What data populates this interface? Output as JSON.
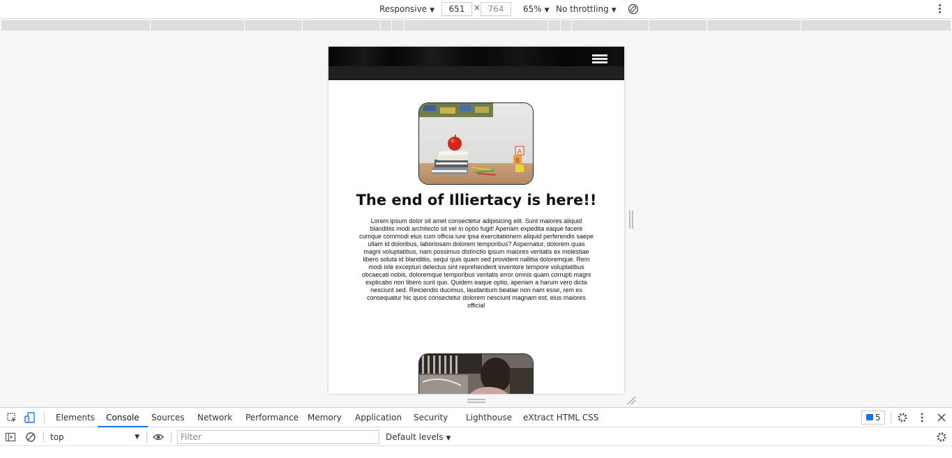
{
  "device_toolbar": {
    "device_mode": "Responsive",
    "width_value": "651",
    "height_value": "764",
    "dimension_separator": "×",
    "zoom": "65%",
    "throttling": "No throttling"
  },
  "page": {
    "headline": "The end of Illiertacy is here!!",
    "body": "Lorem ipsum dolor sit amet consectetur adipisicing elit. Sunt maiores aliquid blanditiis modi architecto sit vel in optio fugit! Aperiam expedita eaque facere cumque commodi eius cum officia iure ipsa exercitationem aliquid perferendis saepe ullam id doloribus, laboriosam dolorem temporibus? Aspernatur, dolorem quas magni voluptatibus, nam possimus distinctio ipsum maiores veritatis ex molestiae libero soluta id blanditiis, sequi quis quam sed provident nallitia doloremque. Rem modi iste excepturi delectus sint reprehenderit inventore tempore voluptatibus obcaecati nobis, doloremque temporibus veritatis error omnis quam corrupti magni explicabo non libero sunt quo. Quidem eaque optio, aperiam a harum vero dicta nesciunt sed. Reiciendis ducimus, laudantium beatae non nam esse, rem ex consequatur hic quos consectetur dolorem nesciunt magnam est, eius maiores officia!"
  },
  "devtools": {
    "tabs": [
      "Elements",
      "Console",
      "Sources",
      "Network",
      "Performance",
      "Memory",
      "Application",
      "Security",
      "Lighthouse",
      "eXtract HTML CSS"
    ],
    "active_tab": "Console",
    "message_count": "5",
    "context": "top",
    "filter_placeholder": "Filter",
    "levels": "Default levels"
  },
  "colors": {
    "accent": "#1a73e8",
    "nav_background": "#0c0c0c"
  }
}
